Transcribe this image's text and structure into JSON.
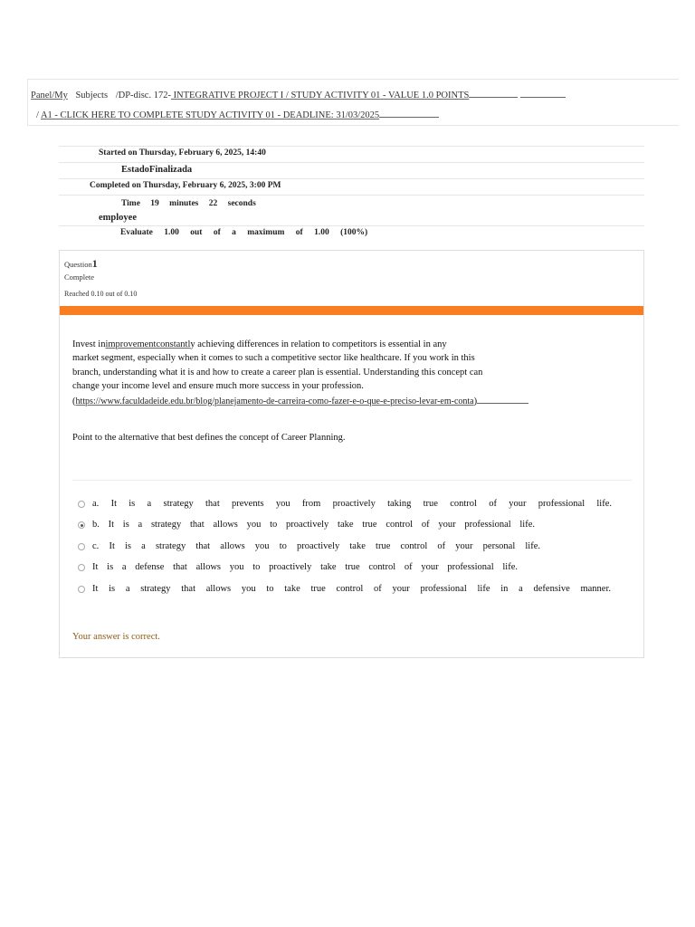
{
  "breadcrumb": {
    "panel": "Panel/My",
    "subjects": "Subjects",
    "discipline_prefix": "/DP-disc. 172-",
    "discipline_link": " INTEGRATIVE PROJECT I / STUDY ACTIVITY 01 - VALUE 1.0 POINTS",
    "sep": "/",
    "activity_link": "A1 - CLICK HERE TO COMPLETE STUDY ACTIVITY 01 - DEADLINE: 31/03/2025"
  },
  "summary": {
    "started": "Started on Thursday, February 6, 2025, 14:40",
    "state": "EstadoFinalizada",
    "completed": "Completed on Thursday, February 6, 2025, 3:00 PM",
    "time": "Time 19 minutes 22 seconds",
    "employee": "employee",
    "evaluate": "Evaluate 1.00 out of a maximum of 1.00 (100%)"
  },
  "question": {
    "label": "Question",
    "number": "1",
    "status": "Complete",
    "grade": "Reached 0.10 out of 0.10",
    "accent_color": "#f97e22",
    "text": {
      "p1": "Invest in",
      "link1": "improvement",
      "link2": "constantl",
      "p2": "y achieving differences in relation to competitors is essential in any",
      "line2": "market segment, especially when it comes to such a competitive sector like healthcare. If you work in this",
      "line3": "branch, understanding what it is and how to create a career plan is essential. Understanding this concept can",
      "line4": "change your income level and ensure much more success in your profession.",
      "paren_open": "(",
      "url": "https://www.faculdadeide.edu.br/blog/planejamento-de-carreira-como-fazer-e-o-que-e-preciso-levar-em-conta",
      "paren_close": ")"
    },
    "prompt": "Point to the alternative that best defines the concept of Career Planning.",
    "answers": [
      {
        "letter": "a.",
        "text": "It is a strategy that prevents you from proactively taking true control of your professional life.",
        "checked": false
      },
      {
        "letter": "b.",
        "text": "It is a strategy that allows you to proactively take true control of your professional life.",
        "checked": true
      },
      {
        "letter": "c.",
        "text": "It is a strategy that allows you to proactively take true control of your personal life.",
        "checked": false
      },
      {
        "letter": "",
        "text": "It is a defense that allows you to proactively take true control of your professional life.",
        "checked": false
      },
      {
        "letter": "",
        "text": "It is a strategy that allows you to take true control of your professional life in a defensive manner.",
        "checked": false
      }
    ],
    "feedback": "Your answer is correct.",
    "feedback_color": "#8e5d12"
  }
}
